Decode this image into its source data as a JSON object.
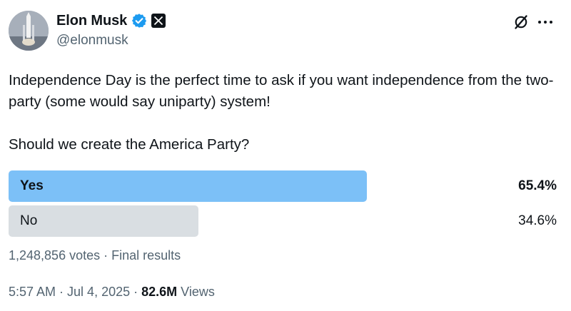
{
  "author": {
    "display_name": "Elon Musk",
    "handle": "@elonmusk",
    "verified": true,
    "avatar_icon": "rocket-launch-avatar"
  },
  "header_actions": {
    "grok_icon": "grok-slash-circle-icon",
    "more_icon": "more-dots-icon"
  },
  "tweet": {
    "text": "Independence Day is the perfect time to ask if you want independence from the two-party (some would say uniparty) system!",
    "question": "Should we create the America Party?"
  },
  "poll": {
    "options": [
      {
        "label": "Yes",
        "percent_text": "65.4%",
        "fraction": 0.654,
        "winner": true
      },
      {
        "label": "No",
        "percent_text": "34.6%",
        "fraction": 0.346,
        "winner": false
      }
    ],
    "votes": "1,248,856 votes",
    "separator": " · ",
    "status": "Final results"
  },
  "meta": {
    "time": "5:57 AM",
    "date": "Jul 4, 2025",
    "separator": " · ",
    "views_count": "82.6M",
    "views_label": " Views"
  },
  "colors": {
    "winner_bar": "#7cc0f7",
    "other_bar": "#d9dee2",
    "verified_blue": "#1d9bf0",
    "secondary_text": "#536471",
    "primary_text": "#0f1419"
  }
}
